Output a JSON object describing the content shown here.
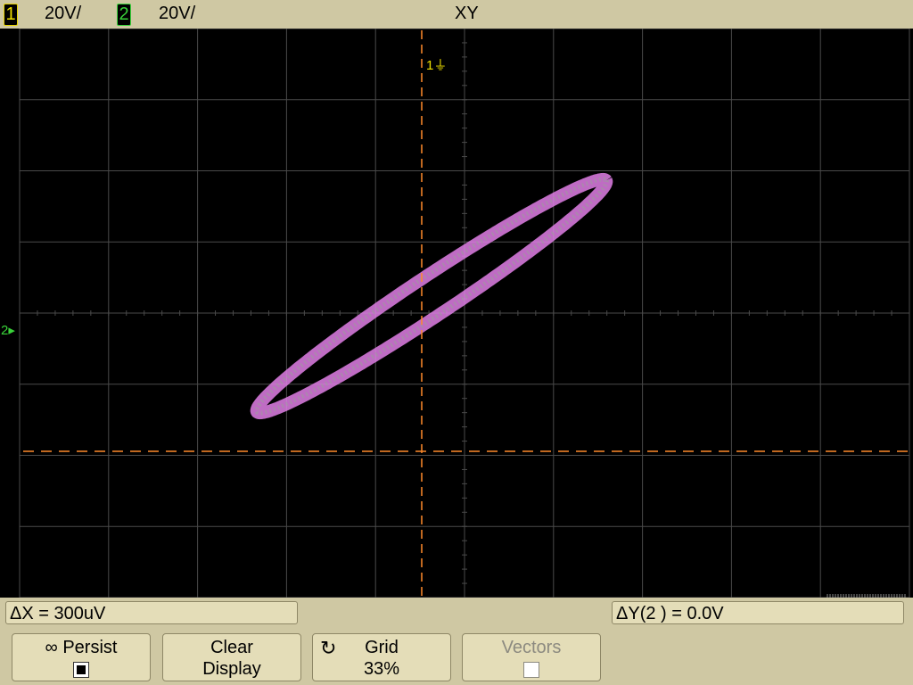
{
  "header": {
    "ch1_label": "1",
    "ch1_scale": "20V/",
    "ch2_label": "2",
    "ch2_scale": "20V/",
    "mode": "XY"
  },
  "screen": {
    "ch1_ground_marker": "1",
    "ch2_ground_marker": "2",
    "trace_color": "#e07fe6",
    "cursor_color": "#ff8a2a",
    "grid_color": "#4a4a4a"
  },
  "measurements": {
    "delta_x": "ΔX = 300uV",
    "delta_y": "ΔY(2 ) = 0.0V"
  },
  "softkeys": {
    "persist_icon": "∞",
    "persist_label": "Persist",
    "persist_checked": true,
    "clear_line1": "Clear",
    "clear_line2": "Display",
    "grid_icon": "↻",
    "grid_label": "Grid",
    "grid_value": "33%",
    "vectors_label": "Vectors",
    "vectors_checked": false
  }
}
